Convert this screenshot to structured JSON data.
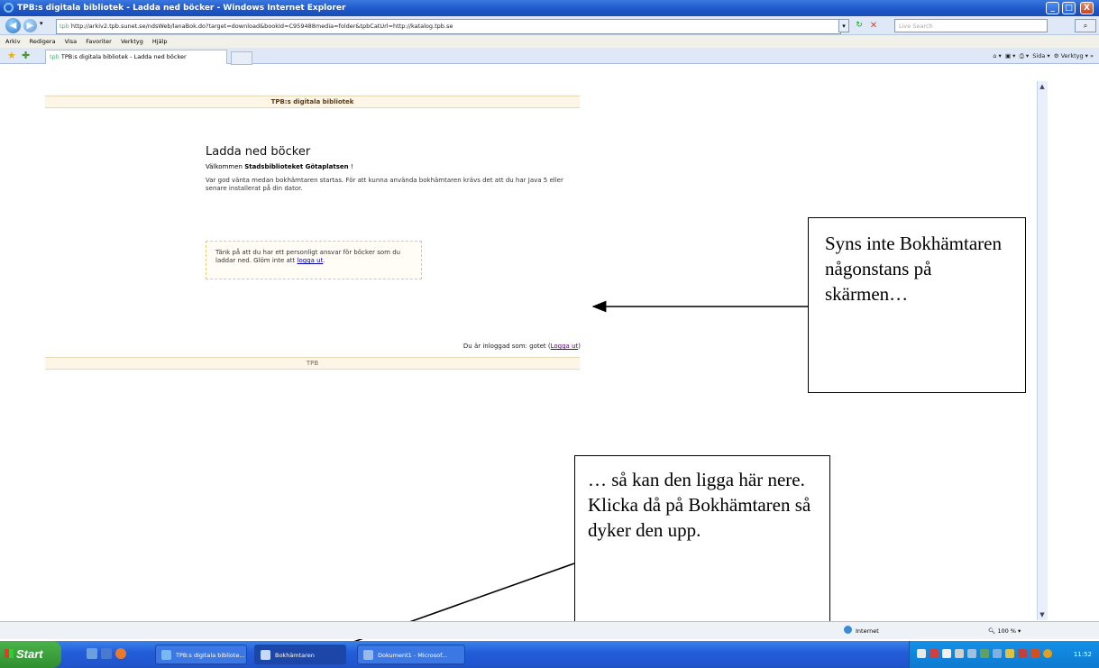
{
  "window": {
    "title": "TPB:s digitala bibliotek - Ladda ned böcker - Windows Internet Explorer",
    "minimize": "_",
    "maximize": "□",
    "close": "X"
  },
  "address": {
    "prefix": "tpb",
    "url": "http://arkiv2.tpb.sunet.se/ndsWeb/lanaBok.do?target=download&bookId=C959488media=folder&tpbCatUrl=http://katalog.tpb.se"
  },
  "search": {
    "placeholder": "Live Search"
  },
  "menu": [
    "Arkiv",
    "Redigera",
    "Visa",
    "Favoriter",
    "Verktyg",
    "Hjälp"
  ],
  "tab": {
    "label": "TPB:s digitala bibliotek - Ladda ned böcker",
    "prefix": "tpb"
  },
  "commandbar": {
    "page": "Sida",
    "tools": "Verktyg"
  },
  "page": {
    "header": "TPB:s digitala bibliotek",
    "title": "Ladda ned böcker",
    "welcome_prefix": "Välkommen",
    "welcome_name": "Stadsbiblioteket Götaplatsen",
    "welcome_suffix": "!",
    "wait_text": "Var god vänta medan bokhämtaren startas. För att kunna använda bokhämtaren krävs det att du har Java 5 eller senare installerat på din dator.",
    "notice_text": "Tänk på att du har ett personligt ansvar för böcker som du laddar ned. Glöm inte att",
    "notice_link": "logga ut",
    "notice_end": ".",
    "logged_prefix": "Du är inloggad som: gotet (",
    "logged_link": "Logga ut",
    "logged_suffix": ")",
    "footer": "TPB"
  },
  "callouts": {
    "right": "Syns inte Bokhämtaren någonstans på skärmen…",
    "bottom": "… så kan den ligga här nere. Klicka då på Bokhämtaren så dyker den upp."
  },
  "status": {
    "zone": "Internet",
    "zoom": "100 %"
  },
  "taskbar": {
    "start": "Start",
    "tasks": [
      {
        "label": "TPB:s digitala bibliote..."
      },
      {
        "label": "Bokhämtaren"
      },
      {
        "label": "Dokument1 - Microsof..."
      }
    ],
    "clock": "11:52"
  }
}
